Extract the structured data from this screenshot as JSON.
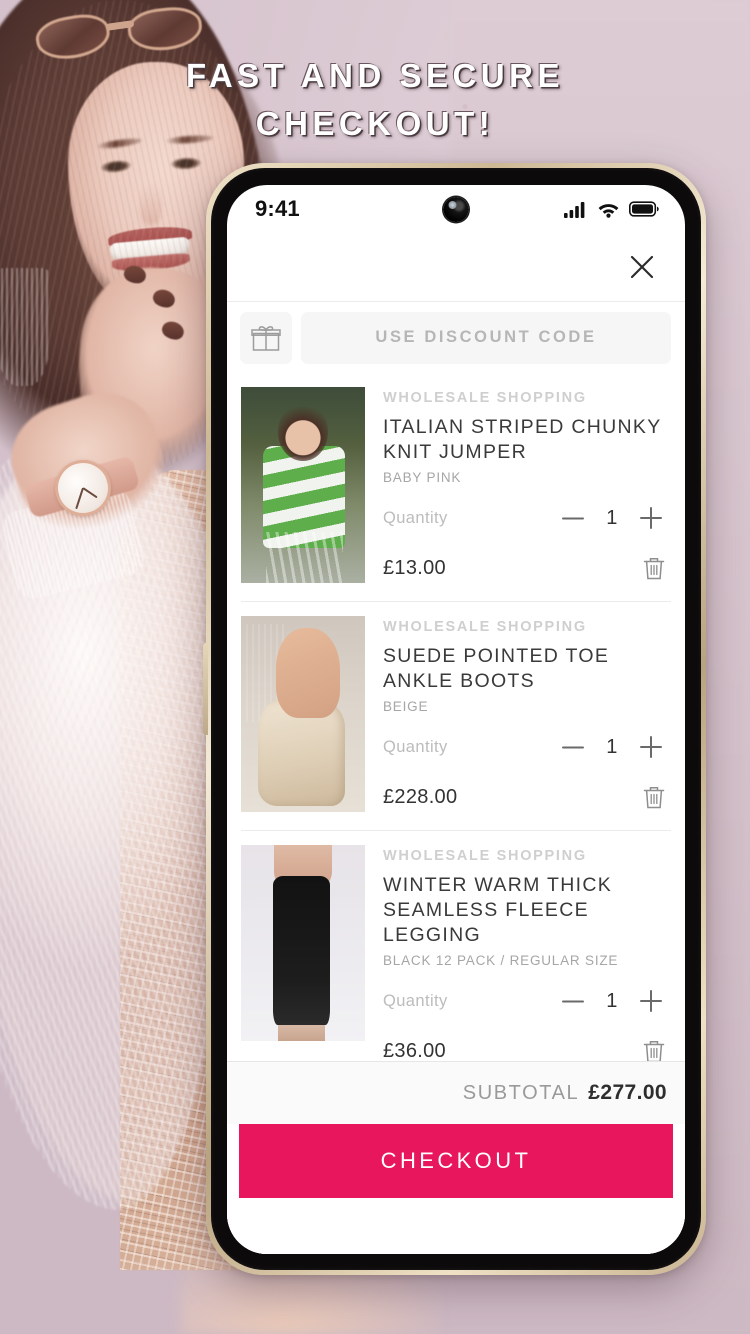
{
  "promo": {
    "headline_line1": "FAST AND SECURE",
    "headline_line2": "CHECKOUT!"
  },
  "statusbar": {
    "time": "9:41",
    "signal_icon": "cellular-signal-icon",
    "wifi_icon": "wifi-icon",
    "battery_icon": "battery-icon",
    "camera_icon": "front-camera-punch-hole"
  },
  "header": {
    "close_icon": "close-icon"
  },
  "discount": {
    "gift_icon": "gift-icon",
    "button_label": "USE DISCOUNT CODE"
  },
  "cart": {
    "items": [
      {
        "brand": "WHOLESALE SHOPPING",
        "title": "ITALIAN STRIPED CHUNKY KNIT JUMPER",
        "variant": "BABY PINK",
        "quantity_label": "Quantity",
        "quantity": "1",
        "decrement_label": "—",
        "increment_label": "+",
        "price": "£13.00",
        "thumb_alt": "striped-green-knit-jumper-photo",
        "remove_icon": "trash-icon"
      },
      {
        "brand": "WHOLESALE SHOPPING",
        "title": "SUEDE POINTED TOE ANKLE BOOTS",
        "variant": "BEIGE",
        "quantity_label": "Quantity",
        "quantity": "1",
        "decrement_label": "—",
        "increment_label": "+",
        "price": "£228.00",
        "thumb_alt": "beige-suede-ankle-boots-photo",
        "remove_icon": "trash-icon"
      },
      {
        "brand": "WHOLESALE SHOPPING",
        "title": "WINTER WARM THICK SEAMLESS FLEECE LEGGING",
        "variant": "BLACK 12 PACK / REGULAR SIZE",
        "quantity_label": "Quantity",
        "quantity": "1",
        "decrement_label": "—",
        "increment_label": "+",
        "price": "£36.00",
        "thumb_alt": "black-fleece-legging-photo",
        "remove_icon": "trash-icon"
      }
    ]
  },
  "footer": {
    "subtotal_label": "SUBTOTAL",
    "subtotal_value": "£277.00",
    "checkout_label": "CHECKOUT"
  },
  "colors": {
    "accent_pink": "#e8165c",
    "background_mauve": "#d8c6cf",
    "phone_bezel_gold": "#cdb894",
    "muted_text": "#b6b6b6"
  }
}
